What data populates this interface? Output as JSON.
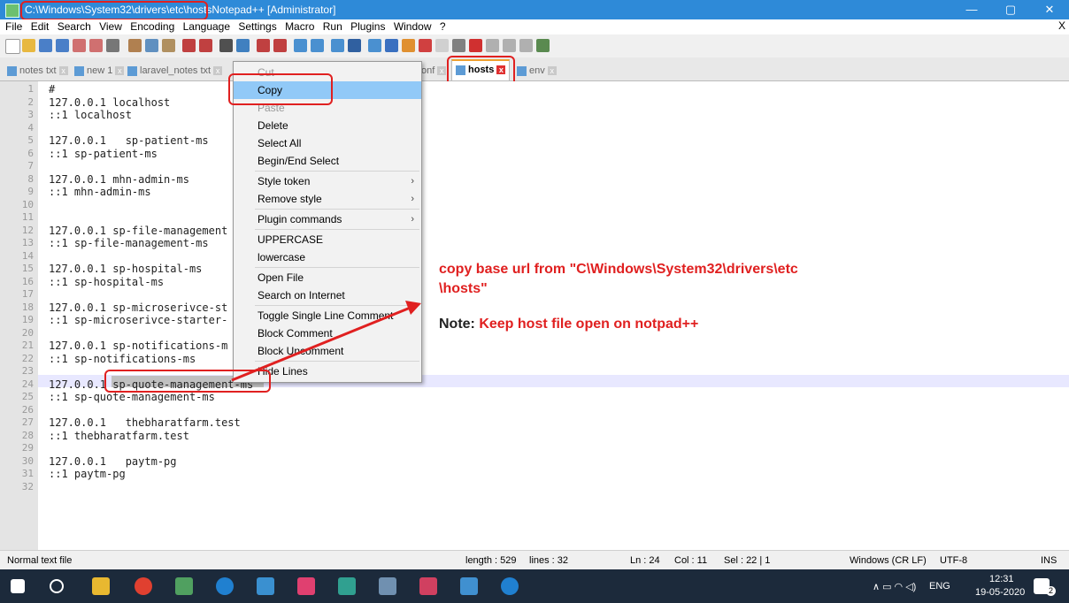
{
  "window": {
    "title_path": "C:\\Windows\\System32\\drivers\\etc\\hosts",
    "title_rest": " - Notepad++ [Administrator]",
    "minimize": "—",
    "maximize": "▢",
    "close": "✕"
  },
  "menubar": {
    "items": [
      "File",
      "Edit",
      "Search",
      "View",
      "Encoding",
      "Language",
      "Settings",
      "Macro",
      "Run",
      "Plugins",
      "Window",
      "?"
    ],
    "close": "X"
  },
  "tabs": [
    {
      "label": "notes txt"
    },
    {
      "label": "new 1"
    },
    {
      "label": "laravel_notes txt"
    },
    {
      "label": "onf"
    },
    {
      "label": "hosts",
      "active": true
    },
    {
      "label": "env"
    }
  ],
  "editor": {
    "lines": [
      "#",
      "127.0.0.1 localhost",
      "::1 localhost",
      "",
      "127.0.0.1   sp-patient-ms",
      "::1 sp-patient-ms",
      "",
      "127.0.0.1 mhn-admin-ms",
      "::1 mhn-admin-ms",
      "",
      "",
      "127.0.0.1 sp-file-management",
      "::1 sp-file-management-ms",
      "",
      "127.0.0.1 sp-hospital-ms",
      "::1 sp-hospital-ms",
      "",
      "127.0.0.1 sp-microserivce-st",
      "::1 sp-microserivce-starter-",
      "",
      "127.0.0.1 sp-notifications-m",
      "::1 sp-notifications-ms",
      "",
      "127.0.0.1 sp-quote-management-ms",
      "::1 sp-quote-management-ms",
      "",
      "127.0.0.1   thebharatfarm.test",
      "::1 thebharatfarm.test",
      "",
      "127.0.0.1   paytm-pg",
      "::1 paytm-pg",
      ""
    ]
  },
  "context_menu": {
    "items": [
      {
        "label": "Cut",
        "dim": true
      },
      {
        "label": "Copy",
        "highlighted": true
      },
      {
        "label": "Paste",
        "dim": true
      },
      {
        "label": "Delete"
      },
      {
        "label": "Select All"
      },
      {
        "label": "Begin/End Select"
      },
      {
        "label": "Style token",
        "submenu": true
      },
      {
        "label": "Remove style",
        "submenu": true
      },
      {
        "label": "Plugin commands",
        "submenu": true
      },
      {
        "label": "UPPERCASE"
      },
      {
        "label": "lowercase"
      },
      {
        "label": "Open File"
      },
      {
        "label": "Search on Internet"
      },
      {
        "label": "Toggle Single Line Comment"
      },
      {
        "label": "Block Comment"
      },
      {
        "label": "Block Uncomment"
      },
      {
        "label": "Hide Lines"
      }
    ]
  },
  "annotation": {
    "line1": "copy base url from \"C\\Windows\\System32\\drivers\\etc",
    "line2": "\\hosts\"",
    "note_label": "Note: ",
    "note_text": "Keep host file open on notpad++",
    "color": "#e02020"
  },
  "statusbar": {
    "filetype": "Normal text file",
    "length": "length : 529",
    "lines": "lines : 32",
    "ln": "Ln : 24",
    "col": "Col : 11",
    "sel": "Sel : 22 | 1",
    "eol": "Windows (CR LF)",
    "encoding": "UTF-8",
    "mode": "INS"
  },
  "taskbar": {
    "tray_lang": "ENG",
    "time": "12:31",
    "date": "19-05-2020",
    "notif_count": "2"
  }
}
